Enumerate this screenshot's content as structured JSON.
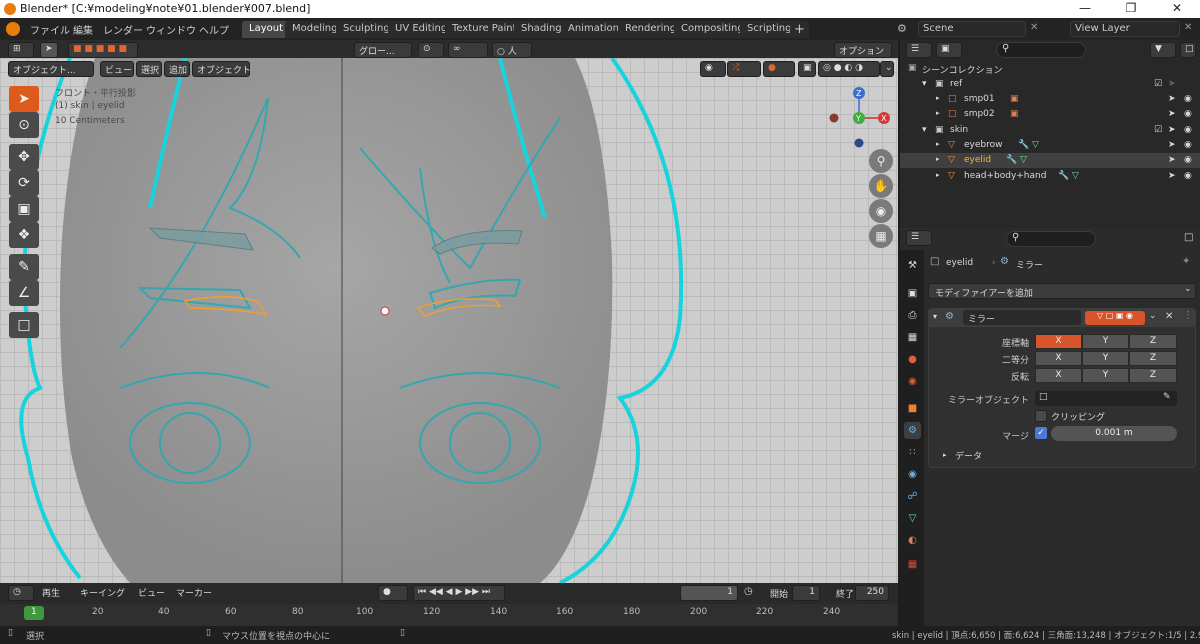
{
  "window": {
    "title": "Blender* [C:¥modeling¥note¥01.blender¥007.blend]"
  },
  "menus": [
    "ファイル",
    "編集",
    "レンダー",
    "ウィンドウ",
    "ヘルプ"
  ],
  "workspaces": [
    {
      "label": "Layout",
      "active": true
    },
    {
      "label": "Modeling"
    },
    {
      "label": "Sculpting"
    },
    {
      "label": "UV Editing"
    },
    {
      "label": "Texture Paint"
    },
    {
      "label": "Shading"
    },
    {
      "label": "Animation"
    },
    {
      "label": "Rendering"
    },
    {
      "label": "Compositing"
    },
    {
      "label": "Scripting"
    }
  ],
  "scene": {
    "name": "Scene",
    "view_layer": "View Layer"
  },
  "viewport": {
    "mode": "オブジェクト...",
    "menus": [
      "ビュー",
      "選択",
      "追加",
      "オブジェクト"
    ],
    "transform_orientation": "グロー...",
    "options": "オプション",
    "overlay_info": {
      "view": "フロント・平行投影",
      "object": "(1) skin | eyelid",
      "scale": "10 Centimeters"
    },
    "gizmo": {
      "x": "X",
      "y": "Y",
      "z": "Z"
    }
  },
  "timeline": {
    "playback": "再生",
    "keying": "キーイング",
    "view": "ビュー",
    "marker": "マーカー",
    "current_frame": "1",
    "start_label": "開始",
    "start": "1",
    "end_label": "終了",
    "end": "250",
    "ticks": [
      "1",
      "20",
      "40",
      "60",
      "80",
      "100",
      "120",
      "140",
      "160",
      "180",
      "200",
      "220",
      "240"
    ]
  },
  "statusbar": {
    "select": "選択",
    "center": "マウス位置を視点の中心に",
    "stats": "skin | eyelid | 頂点:6,650 | 面:6,624 | 三角面:13,248 | オブジェクト:1/5 | 2.92.0"
  },
  "outliner": {
    "root": "シーンコレクション",
    "rows": [
      {
        "label": "ref",
        "level": 1
      },
      {
        "label": "smp01",
        "level": 2
      },
      {
        "label": "smp02",
        "level": 2
      },
      {
        "label": "skin",
        "level": 1
      },
      {
        "label": "eyebrow",
        "level": 2
      },
      {
        "label": "eyelid",
        "level": 2,
        "selected": true
      },
      {
        "label": "head+body+hand",
        "level": 2
      }
    ]
  },
  "properties": {
    "object": "eyelid",
    "context": "ミラー",
    "add_modifier": "モディファイアーを追加",
    "modifier": {
      "name": "ミラー",
      "axis_label": "座標軸",
      "bisect_label": "二等分",
      "flip_label": "反転",
      "axes": [
        "X",
        "Y",
        "Z"
      ],
      "mirror_object_label": "ミラーオブジェクト",
      "clipping_label": "クリッピング",
      "merge_label": "マージ",
      "merge_value": "0.001 m",
      "data_label": "データ"
    }
  },
  "colors": {
    "accent": "#dd5a1a",
    "selected_text": "#ffaf29",
    "header": "#2c2c2c",
    "panel": "#2b2b2b"
  }
}
